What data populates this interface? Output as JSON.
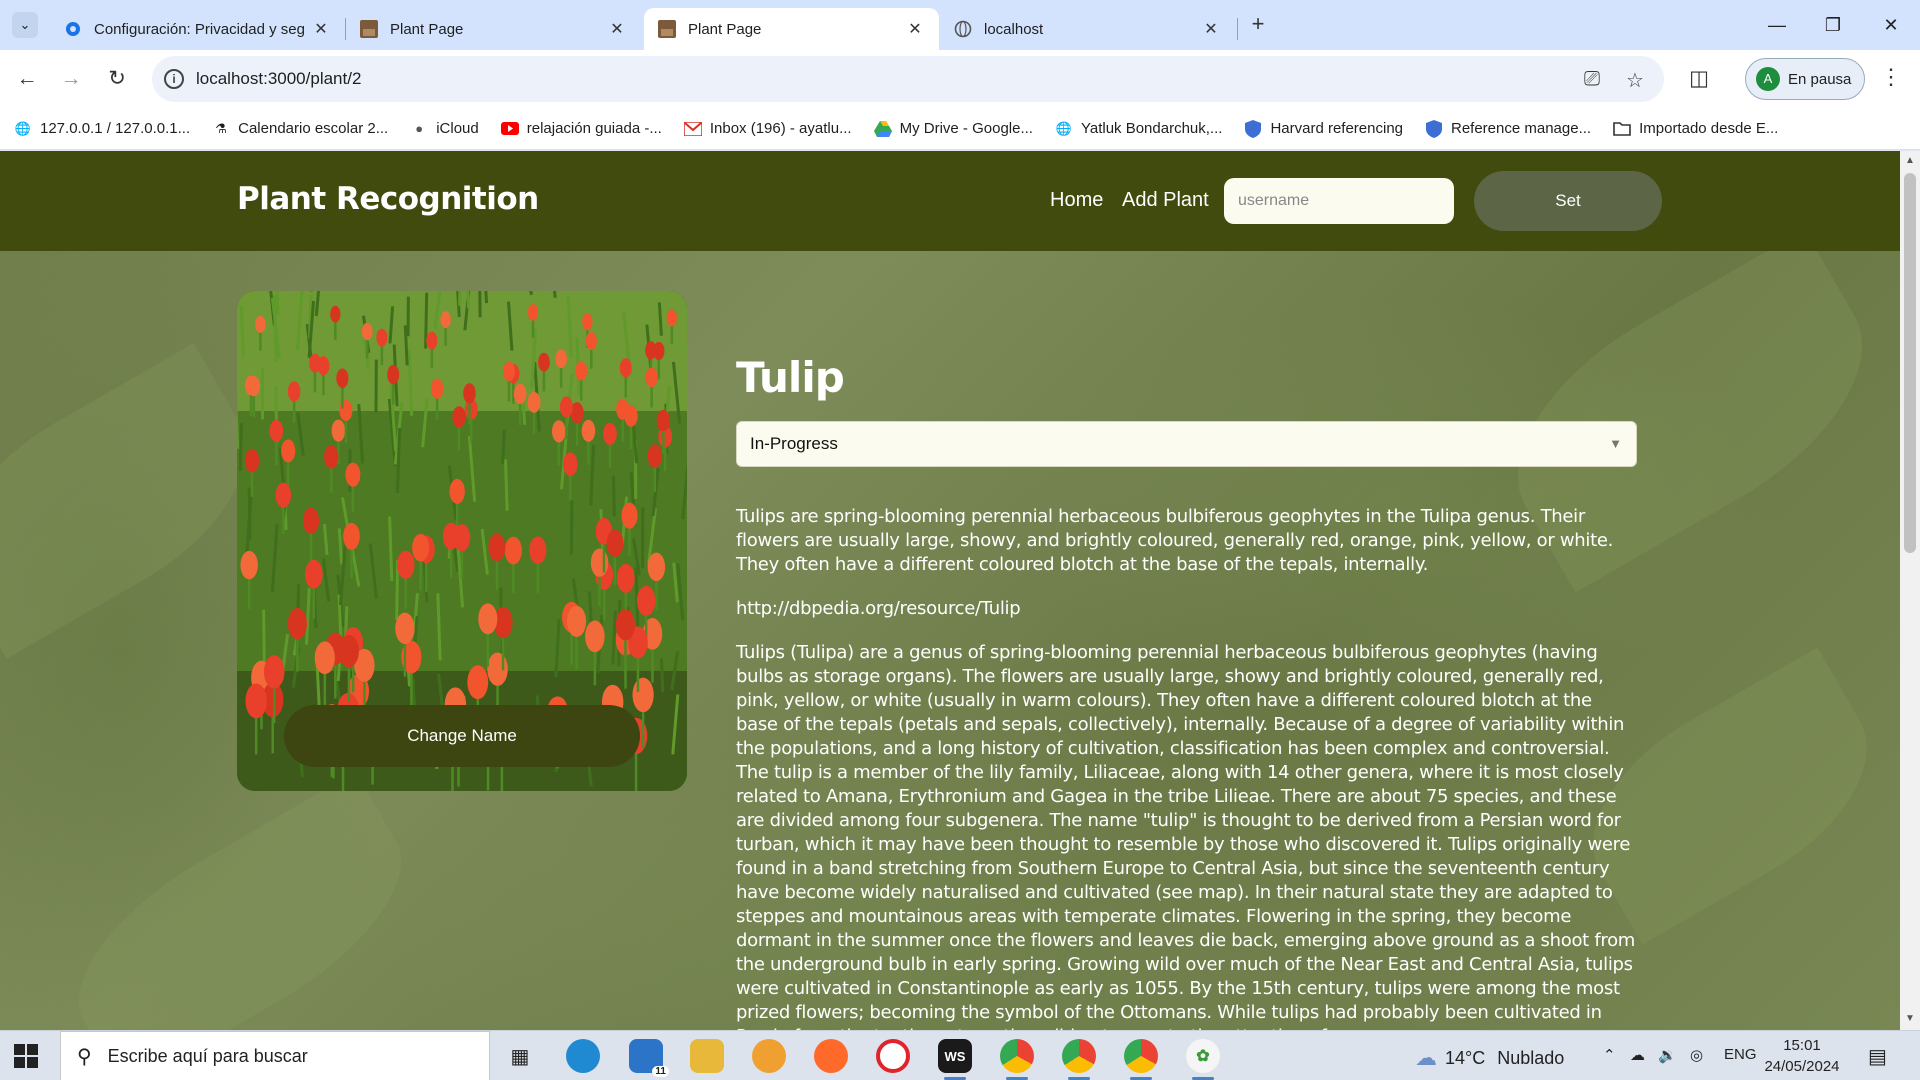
{
  "browser": {
    "tabs": [
      {
        "title": "Configuración: Privacidad y seg",
        "icon": "settings-gear-icon"
      },
      {
        "title": "Plant Page",
        "icon": "plant-image-icon"
      },
      {
        "title": "Plant Page",
        "icon": "plant-image-icon",
        "active": true
      },
      {
        "title": "localhost",
        "icon": "globe-icon"
      }
    ],
    "url": "localhost:3000/plant/2",
    "profile_initial": "A",
    "profile_label": "En pausa",
    "bookmarks": [
      {
        "label": "127.0.0.1 / 127.0.0.1...",
        "icon": "globe-icon"
      },
      {
        "label": "Calendario escolar 2...",
        "icon": "calendar-figures-icon"
      },
      {
        "label": "iCloud",
        "icon": "apple-icon"
      },
      {
        "label": "relajación guiada -...",
        "icon": "youtube-icon"
      },
      {
        "label": "Inbox (196) - ayatlu...",
        "icon": "gmail-icon"
      },
      {
        "label": "My Drive - Google...",
        "icon": "google-drive-icon"
      },
      {
        "label": "Yatluk Bondarchuk,...",
        "icon": "globe-icon"
      },
      {
        "label": "Harvard referencing",
        "icon": "shield-icon"
      },
      {
        "label": "Reference manage...",
        "icon": "shield-icon"
      },
      {
        "label": "Importado desde E...",
        "icon": "folder-icon"
      }
    ]
  },
  "app": {
    "brand": "Plant Recognition",
    "nav": {
      "home": "Home",
      "add_plant": "Add Plant"
    },
    "username_placeholder": "username",
    "set_button": "Set",
    "change_name_button": "Change Name",
    "plant": {
      "name": "Tulip",
      "status": "In-Progress",
      "summary": "Tulips are spring-blooming perennial herbaceous bulbiferous geophytes in the Tulipa genus. Their flowers are usually large, showy, and brightly coloured, generally red, orange, pink, yellow, or white. They often have a different coloured blotch at the base of the tepals, internally.",
      "dbpedia_uri": "http://dbpedia.org/resource/Tulip",
      "abstract": "Tulips (Tulipa) are a genus of spring-blooming perennial herbaceous bulbiferous geophytes (having bulbs as storage organs). The flowers are usually large, showy and brightly coloured, generally red, pink, yellow, or white (usually in warm colours). They often have a different coloured blotch at the base of the tepals (petals and sepals, collectively), internally. Because of a degree of variability within the populations, and a long history of cultivation, classification has been complex and controversial. The tulip is a member of the lily family, Liliaceae, along with 14 other genera, where it is most closely related to Amana, Erythronium and Gagea in the tribe Lilieae. There are about 75 species, and these are divided among four subgenera. The name \"tulip\" is thought to be derived from a Persian word for turban, which it may have been thought to resemble by those who discovered it. Tulips originally were found in a band stretching from Southern Europe to Central Asia, but since the seventeenth century have become widely naturalised and cultivated (see map). In their natural state they are adapted to steppes and mountainous areas with temperate climates. Flowering in the spring, they become dormant in the summer once the flowers and leaves die back, emerging above ground as a shoot from the underground bulb in early spring. Growing wild over much of the Near East and Central Asia, tulips were cultivated in Constantinople as early as 1055. By the 15th century, tulips were among the most prized flowers; becoming the symbol of the Ottomans. While tulips had probably been cultivated in Persia from the tenth century, they did not come to the attention of"
    }
  },
  "taskbar": {
    "search_placeholder": "Escribe aquí para buscar",
    "mail_badge": "11",
    "webstorm_label": "WS",
    "weather_temp": "14°C",
    "weather_text": "Nublado",
    "language": "ENG",
    "time": "15:01",
    "date": "24/05/2024"
  },
  "colors": {
    "navbar": "#414b0e",
    "set_button": "#5c6545",
    "change_name_button": "#3d4610",
    "input_background": "#fbfbef"
  }
}
